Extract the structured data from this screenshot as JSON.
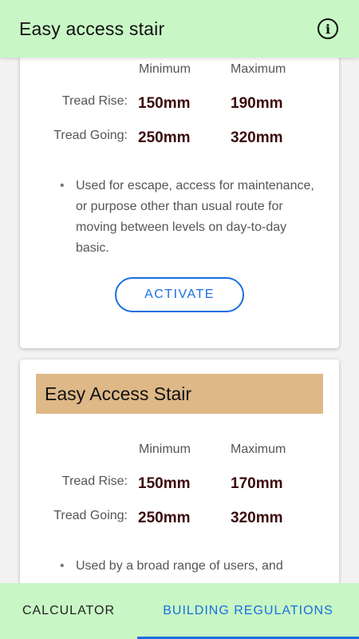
{
  "app_bar": {
    "title": "Easy access stair",
    "info_icon": "info-icon"
  },
  "cards": [
    {
      "min_label": "Minimum",
      "max_label": "Maximum",
      "rows": [
        {
          "label": "Tread Rise:",
          "min": "150mm",
          "max": "190mm"
        },
        {
          "label": "Tread Going:",
          "min": "250mm",
          "max": "320mm"
        }
      ],
      "note": "Used for escape, access for maintenance, or purpose other than usual route for moving between levels on day-to-day basic.",
      "button": "ACTIVATE"
    },
    {
      "heading": "Easy Access Stair",
      "min_label": "Minimum",
      "max_label": "Maximum",
      "rows": [
        {
          "label": "Tread Rise:",
          "min": "150mm",
          "max": "170mm"
        },
        {
          "label": "Tread Going:",
          "min": "250mm",
          "max": "320mm"
        }
      ],
      "note": "Used by a broad range of users, and"
    }
  ],
  "bottom_nav": {
    "tabs": [
      {
        "label": "CALCULATOR",
        "active": false
      },
      {
        "label": "BUILDING REGULATIONS",
        "active": true
      }
    ]
  },
  "colors": {
    "accent": "#1a6fe0",
    "bars": "#c8f7c5",
    "heading": "#deb887",
    "value": "#3b0a0a"
  }
}
